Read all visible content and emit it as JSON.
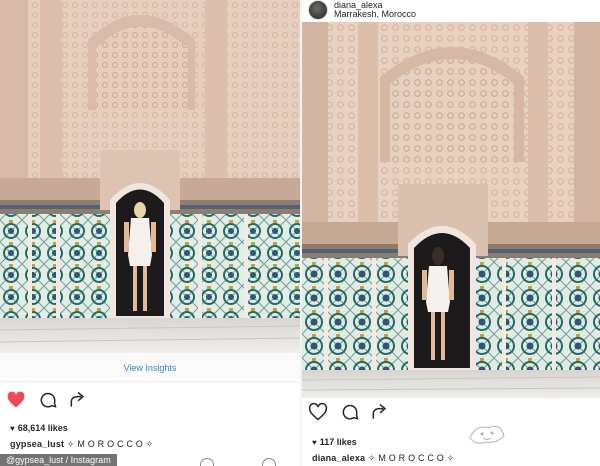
{
  "left_post": {
    "view_insights": "View Insights",
    "likes_icon": "heart-filled",
    "likes": "68,614 likes",
    "caption_user": "gypsea_lust",
    "caption_text": " ✧ M O R O C C O ✧"
  },
  "right_post": {
    "username": "diana_alexa",
    "location": "Marrakesh, Morocco",
    "likes_icon": "heart-mini",
    "likes": "117 likes",
    "caption_user": "diana_alexa",
    "caption_text": " ✧ M O R O C C O ✧"
  },
  "credit": "@gypsea_lust / Instagram",
  "colors": {
    "like_red": "#ed4956",
    "link_blue": "#3b83c4",
    "stucco": "#e9d2c4",
    "tile_teal": "#1f6c66"
  }
}
